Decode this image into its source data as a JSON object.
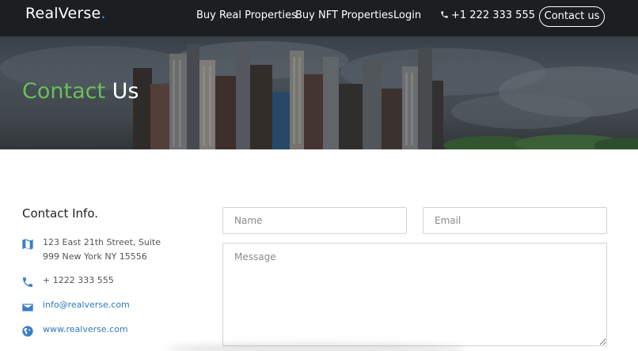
{
  "header": {
    "logo": "RealVerse",
    "logo_dot": ".",
    "nav": {
      "buy_real": "Buy Real Properties",
      "buy_nft": "Buy NFT Properties",
      "login": "Login"
    },
    "phone": "+1 222 333 555",
    "contact_button": "Contact us"
  },
  "hero": {
    "title_accent": "Contact",
    "title_rest": "Us"
  },
  "contact_info": {
    "heading": "Contact Info.",
    "address_line1": "123 East 21th Street, Suite",
    "address_line2": "999 New York NY 15556",
    "phone": "+ 1222 333 555",
    "email": "info@realverse.com",
    "website": "www.realverse.com"
  },
  "form": {
    "name_placeholder": "Name",
    "email_placeholder": "Email",
    "message_placeholder": "Message"
  },
  "colors": {
    "accent_green": "#6abf5a",
    "link_blue": "#2f79bd",
    "icon_blue": "#3a7fc4",
    "nav_background": "#1c1f22"
  }
}
